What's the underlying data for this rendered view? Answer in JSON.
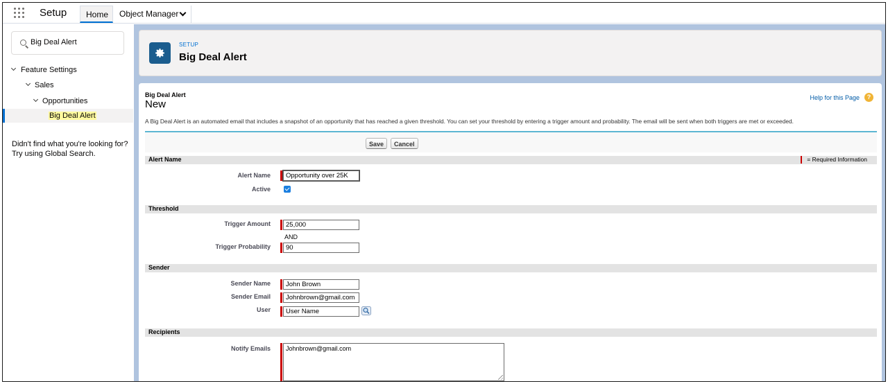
{
  "topnav": {
    "app_name": "Setup",
    "tabs": [
      {
        "label": "Home"
      },
      {
        "label": "Object Manager"
      }
    ]
  },
  "sidebar": {
    "search_value": "Big Deal Alert",
    "tree": [
      {
        "label": "Feature Settings"
      },
      {
        "label": "Sales"
      },
      {
        "label": "Opportunities"
      },
      {
        "label": "Big Deal Alert"
      }
    ],
    "help_line1": "Didn't find what you're looking for?",
    "help_line2": "Try using Global Search."
  },
  "header": {
    "breadcrumb": "SETUP",
    "title": "Big Deal Alert"
  },
  "page": {
    "object_title": "Big Deal Alert",
    "sub_title": "New",
    "help_link": "Help for this Page",
    "description": "A Big Deal Alert is an automated email that includes a snapshot of an opportunity that has reached a given threshold. You can set your threshold by entering a trigger amount and probability. The email will be sent when both triggers are met or exceeded.",
    "save_label": "Save",
    "cancel_label": "Cancel",
    "required_legend": "= Required Information"
  },
  "sections": {
    "alert_name": {
      "title": "Alert Name",
      "alert_name_label": "Alert Name",
      "alert_name_value": "Opportunity over 25K",
      "active_label": "Active",
      "active_checked": true
    },
    "threshold": {
      "title": "Threshold",
      "trigger_amount_label": "Trigger Amount",
      "trigger_amount_value": "25,000",
      "and_text": "AND",
      "trigger_probability_label": "Trigger Probability",
      "trigger_probability_value": "90"
    },
    "sender": {
      "title": "Sender",
      "sender_name_label": "Sender Name",
      "sender_name_value": "John Brown",
      "sender_email_label": "Sender Email",
      "sender_email_value": "Johnbrown@gmail.com",
      "user_label": "User",
      "user_value": "User Name"
    },
    "recipients": {
      "title": "Recipients",
      "notify_emails_label": "Notify Emails",
      "notify_emails_value": "Johnbrown@gmail.com"
    }
  },
  "colors": {
    "brand_blue": "#0070d2",
    "required_red": "#cc0000",
    "header_icon_bg": "#1b5d8e",
    "panel_bg": "#b0c4df"
  },
  "icons": {
    "app_launcher": "waffle-icon",
    "search": "search-icon",
    "header": "gear-icon",
    "help": "help-icon",
    "lookup": "lookup-magnifier-icon"
  }
}
